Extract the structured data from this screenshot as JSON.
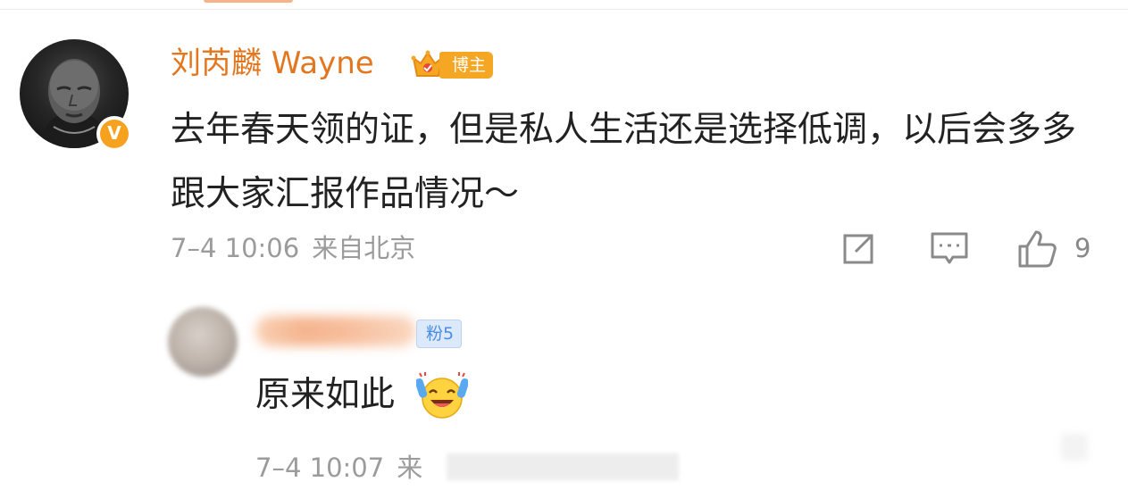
{
  "main_comment": {
    "username": "刘芮麟 Wayne",
    "badge_label": "博主",
    "verified_mark": "V",
    "text": "去年春天领的证，但是私人生活还是选择低调，以后会多多跟大家汇报作品情况～",
    "timestamp": "7–4 10:06",
    "source": "来自北京",
    "like_count": "9",
    "icons": {
      "share": "share-edit-icon",
      "reply": "comment-bubble-icon",
      "like": "thumbs-up-icon",
      "crown": "crown-icon"
    }
  },
  "reply": {
    "fan_badge_label": "粉5",
    "text": "原来如此",
    "emoji": "laughing-crying-emoji",
    "timestamp": "7–4 10:07",
    "source": "来"
  },
  "colors": {
    "username": "#e3771f",
    "badge": "#f5a623",
    "verified": "#f7a21f",
    "meta_text": "#9b9b9b",
    "fan_badge": "#4a8ee3"
  }
}
